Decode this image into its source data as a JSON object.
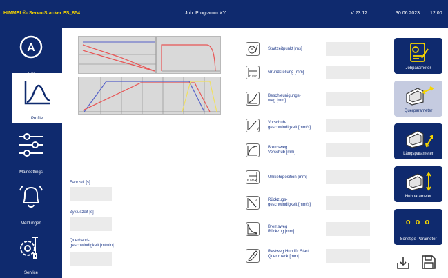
{
  "header": {
    "brand": "HIMMEL®- Servo-Stacker ES_854",
    "job": "Job: Programm XY",
    "version": "V 23.12",
    "date": "30.06.2023",
    "time": "12:00"
  },
  "sidebar": {
    "items": [
      {
        "label": "Auto",
        "icon": "auto-icon"
      },
      {
        "label": "Profile",
        "icon": "profile-icon"
      },
      {
        "label": "Mainsettings",
        "icon": "sliders-icon"
      },
      {
        "label": "Meldungen",
        "icon": "bell-icon"
      },
      {
        "label": "Service",
        "icon": "service-icon"
      }
    ]
  },
  "left_fields": [
    {
      "label": "Fahrzeit [s]"
    },
    {
      "label": "Zykluszeit [s]"
    },
    {
      "label": "Querband-\ngeschwindigkeit [m/min]"
    }
  ],
  "params": [
    {
      "label": "Startzeitpunkt [ms]",
      "icon": "start-time-icon"
    },
    {
      "label": "Grundstellung [mm]",
      "icon": "p-min-icon",
      "icon_text": "P MIN"
    },
    {
      "label": "Beschleunigungs-\nweg [mm]",
      "icon": "acceleration-icon"
    },
    {
      "label": "Vorschub-\ngeschwindigkeit [mm/s]",
      "icon": "feed-speed-icon",
      "icon_text": "V"
    },
    {
      "label": "Bremsweg\nVorschub [mm]",
      "icon": "brake-feed-icon"
    },
    {
      "label": "Umkehrposition [mm]",
      "icon": "p-max-icon",
      "icon_text": "P MAX"
    },
    {
      "label": "Rückzugs-\ngeschwindigkeit [mm/s]",
      "icon": "return-speed-icon",
      "icon_text": "V"
    },
    {
      "label": "Bremsweg\nRückzug [mm]",
      "icon": "brake-return-icon"
    },
    {
      "label": "Restweg Hub für Start\nQuer rueck [mm]",
      "icon": "rest-travel-icon"
    }
  ],
  "right_buttons": [
    {
      "label": "Jobparameter",
      "icon": "job-parameter-icon"
    },
    {
      "label": "Querparameter",
      "icon": "cross-parameter-icon"
    },
    {
      "label": "Längsparameter",
      "icon": "longitudinal-parameter-icon"
    },
    {
      "label": "Hubparameter",
      "icon": "lift-parameter-icon"
    },
    {
      "label": "Sonstige Parameter",
      "icon": "more-icon",
      "icon_text": "o o o"
    }
  ],
  "colors": {
    "navy": "#0f2a6e",
    "accent_yellow": "#f5d400",
    "curve_red": "#e85555",
    "curve_blue": "#5560c8",
    "curve_yellow": "#f0e060"
  }
}
